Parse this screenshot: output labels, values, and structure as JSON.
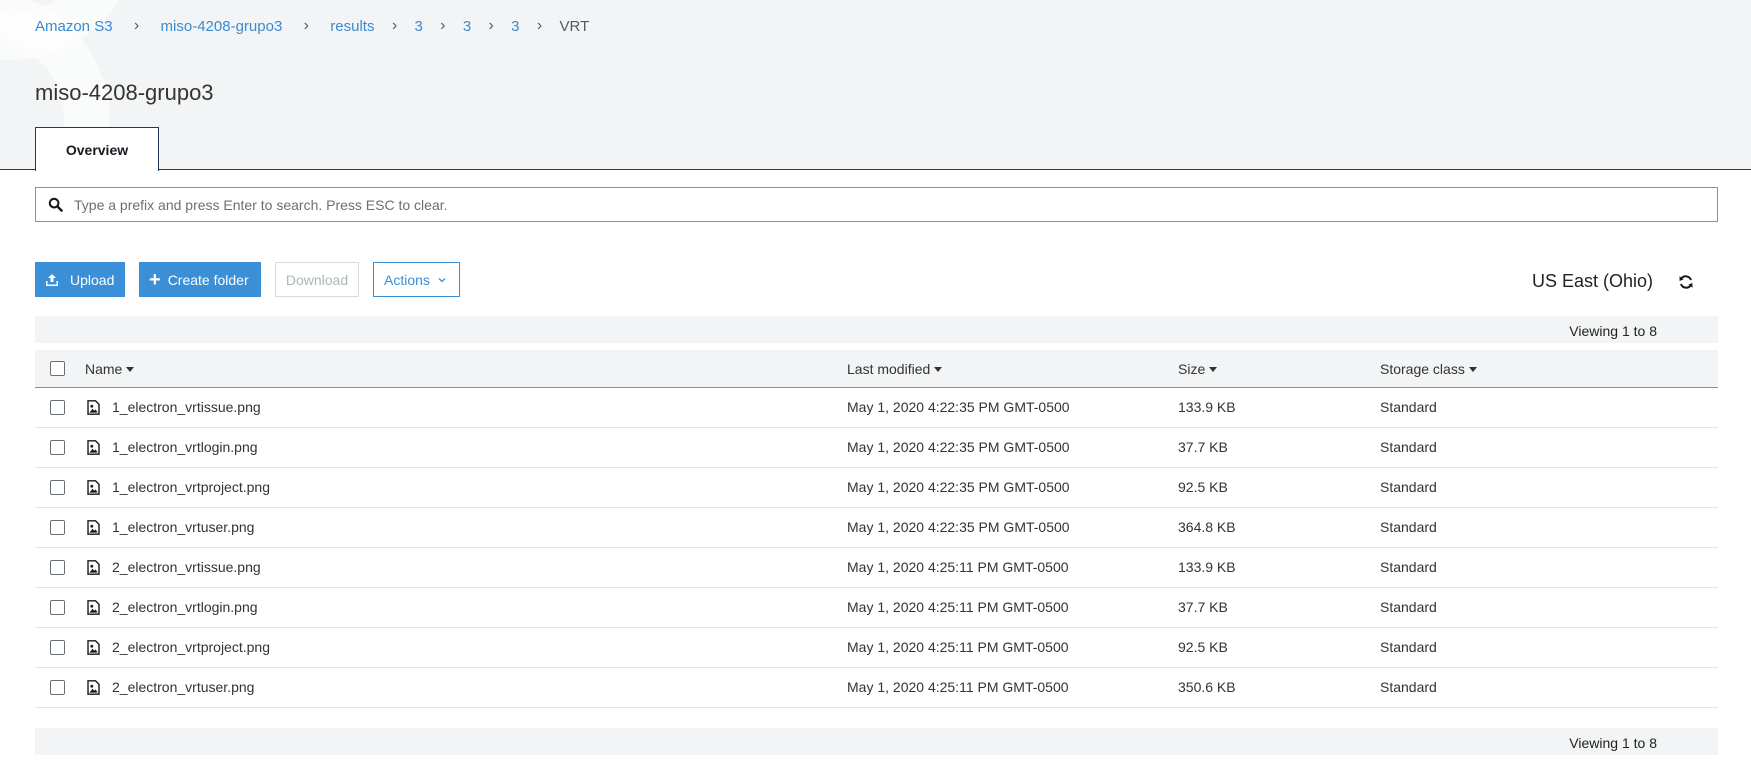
{
  "breadcrumb": {
    "items": [
      "Amazon S3",
      "miso-4208-grupo3",
      "results",
      "3",
      "3",
      "3"
    ],
    "current": "VRT"
  },
  "page_title": "miso-4208-grupo3",
  "tabs": [
    {
      "label": "Overview",
      "active": true
    }
  ],
  "search": {
    "placeholder": "Type a prefix and press Enter to search. Press ESC to clear.",
    "value": ""
  },
  "toolbar": {
    "upload_label": "Upload",
    "create_folder_label": "Create folder",
    "download_label": "Download",
    "actions_label": "Actions"
  },
  "region": "US East (Ohio)",
  "viewing": {
    "top": "Viewing 1 to 8",
    "bottom": "Viewing 1 to 8"
  },
  "table": {
    "columns": [
      "Name",
      "Last modified",
      "Size",
      "Storage class"
    ],
    "rows": [
      {
        "name": "1_electron_vrtissue.png",
        "modified": "May 1, 2020 4:22:35 PM GMT-0500",
        "size": "133.9 KB",
        "storage": "Standard"
      },
      {
        "name": "1_electron_vrtlogin.png",
        "modified": "May 1, 2020 4:22:35 PM GMT-0500",
        "size": "37.7 KB",
        "storage": "Standard"
      },
      {
        "name": "1_electron_vrtproject.png",
        "modified": "May 1, 2020 4:22:35 PM GMT-0500",
        "size": "92.5 KB",
        "storage": "Standard"
      },
      {
        "name": "1_electron_vrtuser.png",
        "modified": "May 1, 2020 4:22:35 PM GMT-0500",
        "size": "364.8 KB",
        "storage": "Standard"
      },
      {
        "name": "2_electron_vrtissue.png",
        "modified": "May 1, 2020 4:25:11 PM GMT-0500",
        "size": "133.9 KB",
        "storage": "Standard"
      },
      {
        "name": "2_electron_vrtlogin.png",
        "modified": "May 1, 2020 4:25:11 PM GMT-0500",
        "size": "37.7 KB",
        "storage": "Standard"
      },
      {
        "name": "2_electron_vrtproject.png",
        "modified": "May 1, 2020 4:25:11 PM GMT-0500",
        "size": "92.5 KB",
        "storage": "Standard"
      },
      {
        "name": "2_electron_vrtuser.png",
        "modified": "May 1, 2020 4:25:11 PM GMT-0500",
        "size": "350.6 KB",
        "storage": "Standard"
      }
    ]
  },
  "icons": {
    "search": "search-icon",
    "upload": "upload-icon",
    "create_folder": "plus-icon",
    "actions": "chevron-down-icon",
    "refresh": "refresh-icon",
    "file": "image-file-icon"
  },
  "colors": {
    "primary": "#3a8fd6",
    "link": "#3b8ad1",
    "header_bg": "#f2f4f5",
    "tab_border": "#1f3a5f"
  }
}
